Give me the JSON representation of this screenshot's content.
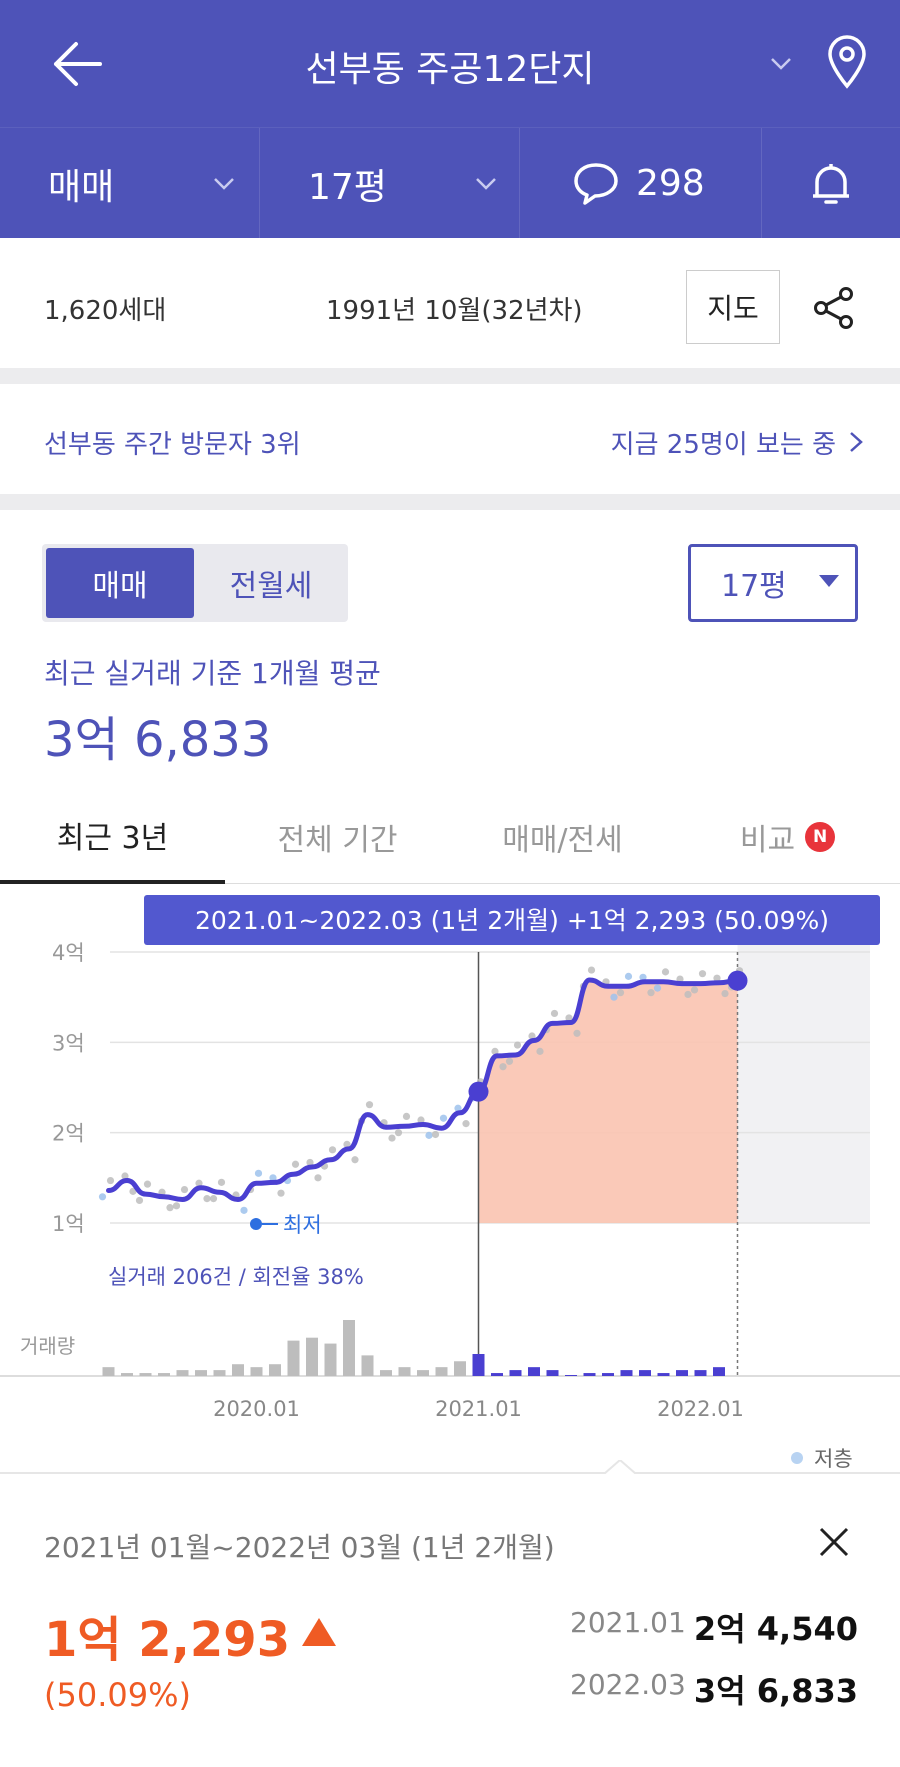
{
  "header": {
    "title": "선부동 주공12단지",
    "trade_type": "매매",
    "size": "17평",
    "comment_count": "298"
  },
  "info": {
    "households": "1,620세대",
    "built": "1991년 10월(32년차)",
    "map_label": "지도"
  },
  "visitors": {
    "rank": "선부동 주간 방문자 3위",
    "now_viewing": "지금 25명이 보는 중"
  },
  "price_panel": {
    "seg_sale": "매매",
    "seg_rent": "전월세",
    "size": "17평",
    "avg_label": "최근 실거래 기준 1개월 평균",
    "avg_value": "3억 6,833"
  },
  "tabs": [
    {
      "label": "최근 3년"
    },
    {
      "label": "전체 기간"
    },
    {
      "label": "매매/전세"
    },
    {
      "label": "비교",
      "badge": "N"
    }
  ],
  "colors": {
    "brand": "#4e53b8",
    "line": "#4a3fd1",
    "highlight_fill": "#f9c3b0",
    "up": "#ef5b24",
    "low_floor_dot": "#9ec2ec"
  },
  "chart_data": {
    "type": "line",
    "y_ticks": [
      "4억",
      "3억",
      "2억",
      "1억"
    ],
    "ylim": [
      1,
      4
    ],
    "x_ticks": [
      "2020.01",
      "2021.01",
      "2022.01"
    ],
    "xlim": [
      "2019.04",
      "2022.08"
    ],
    "tooltip": "2021.01~2022.03 (1년 2개월)  +1억 2,293 (50.09%)",
    "low_label": "최저",
    "stats_label": "실거래 206건 / 회전율 38%",
    "volume_label": "거래량",
    "legend_low_floor": "저층",
    "price_line": [
      {
        "x": "2019.05",
        "y": 1.36
      },
      {
        "x": "2019.06",
        "y": 1.47
      },
      {
        "x": "2019.07",
        "y": 1.32
      },
      {
        "x": "2019.08",
        "y": 1.29
      },
      {
        "x": "2019.09",
        "y": 1.26
      },
      {
        "x": "2019.10",
        "y": 1.39
      },
      {
        "x": "2019.11",
        "y": 1.34
      },
      {
        "x": "2019.12",
        "y": 1.26
      },
      {
        "x": "2020.01",
        "y": 1.44
      },
      {
        "x": "2020.02",
        "y": 1.45
      },
      {
        "x": "2020.03",
        "y": 1.54
      },
      {
        "x": "2020.04",
        "y": 1.62
      },
      {
        "x": "2020.05",
        "y": 1.7
      },
      {
        "x": "2020.06",
        "y": 1.82
      },
      {
        "x": "2020.07",
        "y": 2.2
      },
      {
        "x": "2020.08",
        "y": 2.06
      },
      {
        "x": "2020.09",
        "y": 2.07
      },
      {
        "x": "2020.10",
        "y": 2.09
      },
      {
        "x": "2020.11",
        "y": 2.05
      },
      {
        "x": "2020.12",
        "y": 2.22
      },
      {
        "x": "2021.01",
        "y": 2.454
      },
      {
        "x": "2021.02",
        "y": 2.85
      },
      {
        "x": "2021.03",
        "y": 2.86
      },
      {
        "x": "2021.04",
        "y": 3.02
      },
      {
        "x": "2021.05",
        "y": 3.21
      },
      {
        "x": "2021.06",
        "y": 3.22
      },
      {
        "x": "2021.07",
        "y": 3.69
      },
      {
        "x": "2021.08",
        "y": 3.62
      },
      {
        "x": "2021.09",
        "y": 3.62
      },
      {
        "x": "2021.10",
        "y": 3.67
      },
      {
        "x": "2021.11",
        "y": 3.67
      },
      {
        "x": "2021.12",
        "y": 3.65
      },
      {
        "x": "2022.01",
        "y": 3.65
      },
      {
        "x": "2022.02",
        "y": 3.66
      },
      {
        "x": "2022.03",
        "y": 3.683
      }
    ],
    "highlight": {
      "from": "2021.01",
      "to": "2022.03"
    },
    "volume": [
      3,
      1,
      1,
      1,
      2,
      2,
      2,
      4,
      3,
      4,
      12,
      13,
      11,
      19,
      7,
      2,
      3,
      2,
      3,
      5,
      7,
      1,
      2,
      3,
      2,
      0,
      1,
      1,
      2,
      2,
      1,
      2,
      2,
      3
    ]
  },
  "detail": {
    "range": "2021년 01월~2022년 03월 (1년 2개월)",
    "change": "1억 2,293",
    "rate": "(50.09%)",
    "start_date": "2021.01",
    "start_price": "2억 4,540",
    "end_date": "2022.03",
    "end_price": "3억 6,833"
  }
}
